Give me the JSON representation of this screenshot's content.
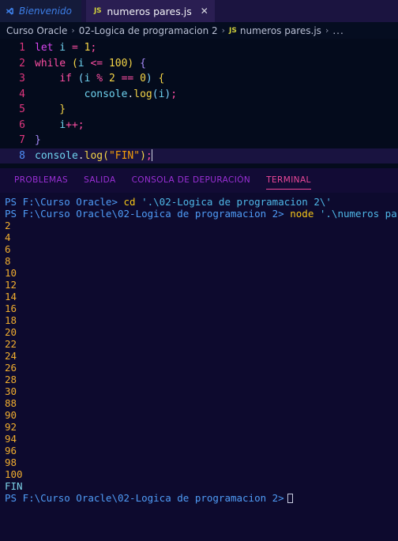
{
  "tabs": {
    "welcome": {
      "label": "Bienvenido",
      "icon": "vscode-logo-icon"
    },
    "active": {
      "label": "numeros pares.js",
      "badge": "JS",
      "close": "✕"
    }
  },
  "breadcrumb": {
    "items": [
      "Curso Oracle",
      "02-Logica de programacion 2",
      "numeros pares.js"
    ],
    "badge": "JS",
    "separator": "›",
    "overflow": "..."
  },
  "editor": {
    "lines": [
      {
        "num": "1",
        "current": false
      },
      {
        "num": "2",
        "current": false
      },
      {
        "num": "3",
        "current": false
      },
      {
        "num": "4",
        "current": false
      },
      {
        "num": "5",
        "current": false
      },
      {
        "num": "6",
        "current": false
      },
      {
        "num": "7",
        "current": false
      },
      {
        "num": "8",
        "current": true
      }
    ],
    "code": {
      "l1_let": "let",
      "l1_i": " i",
      "l1_eq": " = ",
      "l1_num": "1",
      "l1_semi": ";",
      "l2_while": "while",
      "l2_p1": " (",
      "l2_i": "i",
      "l2_op": " <= ",
      "l2_num": "100",
      "l2_p2": ")",
      "l2_brace": " {",
      "l3_indent": "    ",
      "l3_if": "if",
      "l3_p1": " (",
      "l3_i": "i",
      "l3_mod": " % ",
      "l3_num2": "2",
      "l3_eqeq": " == ",
      "l3_num0": "0",
      "l3_p2": ")",
      "l3_brace": " {",
      "l4_indent": "        ",
      "l4_console": "console",
      "l4_dot": ".",
      "l4_log": "log",
      "l4_p1": "(",
      "l4_i": "i",
      "l4_p2": ")",
      "l4_semi": ";",
      "l5_brace": "    }",
      "l6_indent": "    ",
      "l6_i": "i",
      "l6_inc": "++",
      "l6_semi": ";",
      "l7_brace": "}",
      "l8_console": "console",
      "l8_dot": ".",
      "l8_log": "log",
      "l8_p1": "(",
      "l8_str": "\"FIN\"",
      "l8_p2": ")",
      "l8_semi": ";"
    }
  },
  "panel": {
    "tabs": [
      {
        "label": "PROBLEMAS",
        "active": false
      },
      {
        "label": "SALIDA",
        "active": false
      },
      {
        "label": "CONSOLA DE DEPURACIÓN",
        "active": false
      },
      {
        "label": "TERMINAL",
        "active": true
      }
    ]
  },
  "terminal": {
    "line1": {
      "prompt": "PS F:\\Curso Oracle>",
      "cmd": " cd",
      "arg": " '.\\02-Logica de programacion 2\\'"
    },
    "line2": {
      "prompt": "PS F:\\Curso Oracle\\02-Logica de programacion 2>",
      "cmd": " node",
      "arg": " '.\\numeros pares.js'"
    },
    "output": [
      "2",
      "4",
      "6",
      "8",
      "10",
      "12",
      "14",
      "16",
      "18",
      "20",
      "22",
      "24",
      "26",
      "28",
      "30",
      "88",
      "90",
      "92",
      "94",
      "96",
      "98",
      "100"
    ],
    "final_output": "FIN",
    "last_prompt": "PS F:\\Curso Oracle\\02-Logica de programacion 2>"
  },
  "colors": {
    "editor_bg": "#040b1c",
    "terminal_bg": "#0d0a2e",
    "tabbar_bg": "#1b1440",
    "panel_header_bg": "#120b35",
    "active_tab_bg": "#2a1e52",
    "accent_pink": "#ec4899",
    "line_number": "#e0367e",
    "current_line_bg": "#191340"
  }
}
